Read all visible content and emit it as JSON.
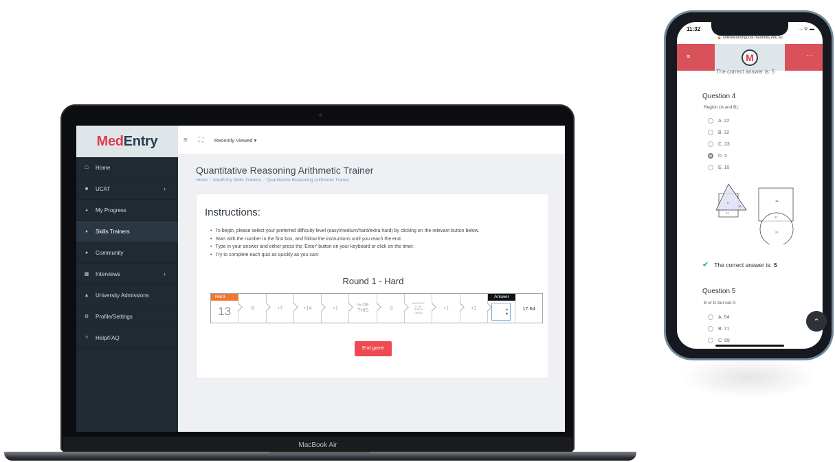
{
  "laptop": {
    "device_label": "MacBook Air",
    "sidebar": {
      "logo_med": "Med",
      "logo_entry": "Entry",
      "items": [
        {
          "label": "Home",
          "icon": "home-icon"
        },
        {
          "label": "UCAT",
          "icon": "grid-icon",
          "chevron": "›"
        },
        {
          "label": "My Progress",
          "icon": "progress-icon"
        },
        {
          "label": "Skills Trainers",
          "icon": "trophy-icon"
        },
        {
          "label": "Community",
          "icon": "chat-icon"
        },
        {
          "label": "Interviews",
          "icon": "interview-icon",
          "chevron": "›"
        },
        {
          "label": "University Admissions",
          "icon": "university-icon"
        },
        {
          "label": "Profile/Settings",
          "icon": "gear-icon"
        },
        {
          "label": "Help/FAQ",
          "icon": "question-icon"
        }
      ],
      "active_index": 3
    },
    "topbar": {
      "recently_viewed": "Recently Viewed"
    },
    "page": {
      "title": "Quantitative Reasoning Arithmetic Trainer",
      "breadcrumb": [
        "Home",
        "MedEntry Skills Trainers",
        "Quantitative Reasoning Arithmetic Trainer"
      ],
      "instructions_title": "Instructions:",
      "instructions": [
        "To begin, please select your preferred difficulty level (easy/medium/hard/extra hard) by clicking on the relevant button below.",
        "Start with the number in the first box, and follow the instructions until you reach the end.",
        "Type in your answer and either press the 'Enter' button on your keyboard or click on the timer.",
        "Try to complete each quiz as quickly as you can!"
      ],
      "round_title": "Round 1 - Hard",
      "difficulty": "Hard",
      "start_number": "13",
      "steps": [
        "-6",
        "+7",
        "+14",
        "+1",
        "½ OF THIS",
        "-3",
        "MULTIPLY IT BY ITSELF TWICE",
        "+1",
        "+2"
      ],
      "answer_label": "Answer",
      "timer": "17.64",
      "end_button": "End game"
    }
  },
  "phone": {
    "time": "11:32",
    "status_right": "... ᯤ ▬",
    "url": "🔒 onlinelearningucat.medentry.edu.au",
    "logo_letter": "M",
    "cut_off_text": "The correct answer is: 5",
    "question4": {
      "title": "Question 4",
      "prompt": "Region (A and B):",
      "options": [
        "A. 22",
        "B. 32",
        "C. 23",
        "D. 5",
        "E. 10"
      ],
      "selected_index": 3
    },
    "venn_values": [
      "5",
      "14",
      "17",
      "27",
      "16",
      "27"
    ],
    "correct_label": "The correct answer is:",
    "correct_value": "5",
    "question5": {
      "title": "Question 5",
      "prompt": "B or D but not A:",
      "options": [
        "A. 54",
        "B. 71",
        "C. 89"
      ]
    }
  }
}
